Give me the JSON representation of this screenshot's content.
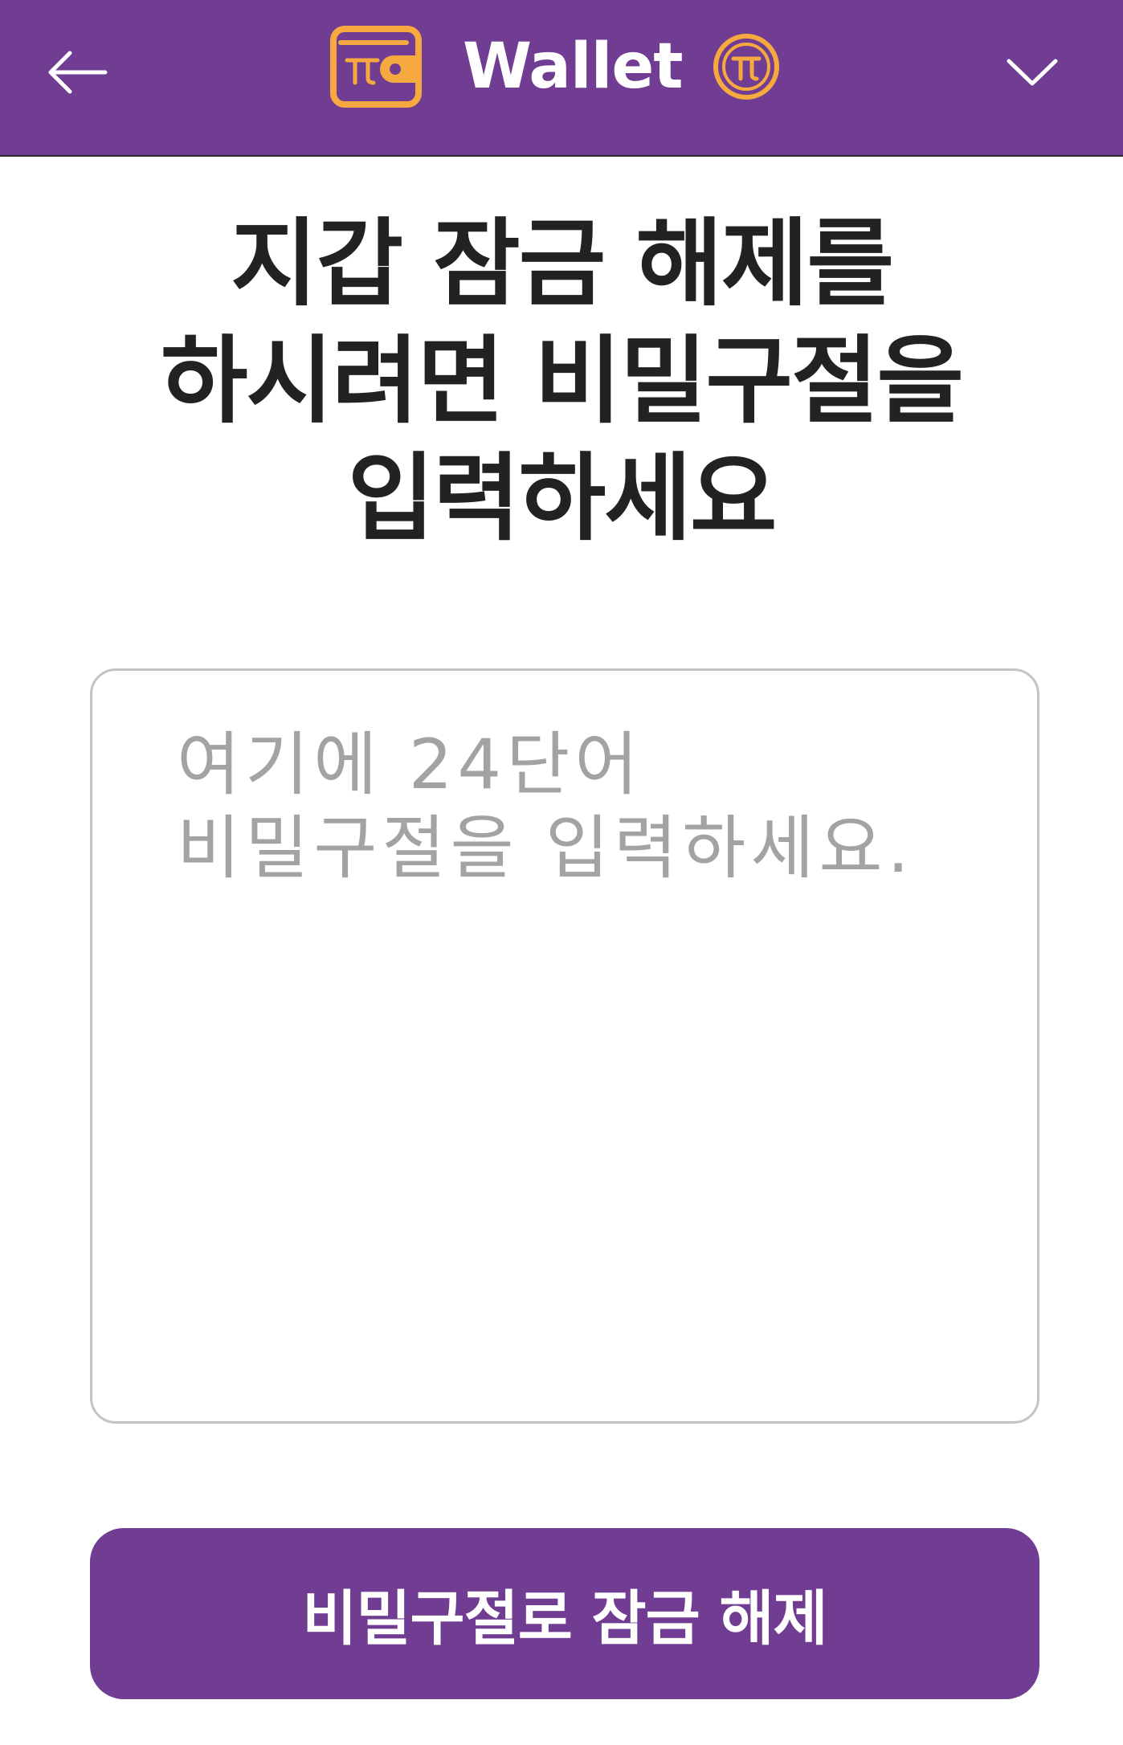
{
  "header": {
    "title": "Wallet",
    "icons": {
      "back": "arrow-left-icon",
      "app_logo": "wallet-icon",
      "coin": "pi-coin-icon",
      "menu": "chevron-down-icon"
    },
    "colors": {
      "background": "#703d92",
      "accent": "#f5a93e",
      "text": "#ffffff"
    }
  },
  "main": {
    "heading": "지갑 잠금 해제를 하시려면 비밀구절을 입력하세요",
    "passphrase_input": {
      "value": "",
      "placeholder": "여기에 24단어 비밀구절을 입력하세요."
    },
    "unlock_button_label": "비밀구절로 잠금 해제"
  }
}
